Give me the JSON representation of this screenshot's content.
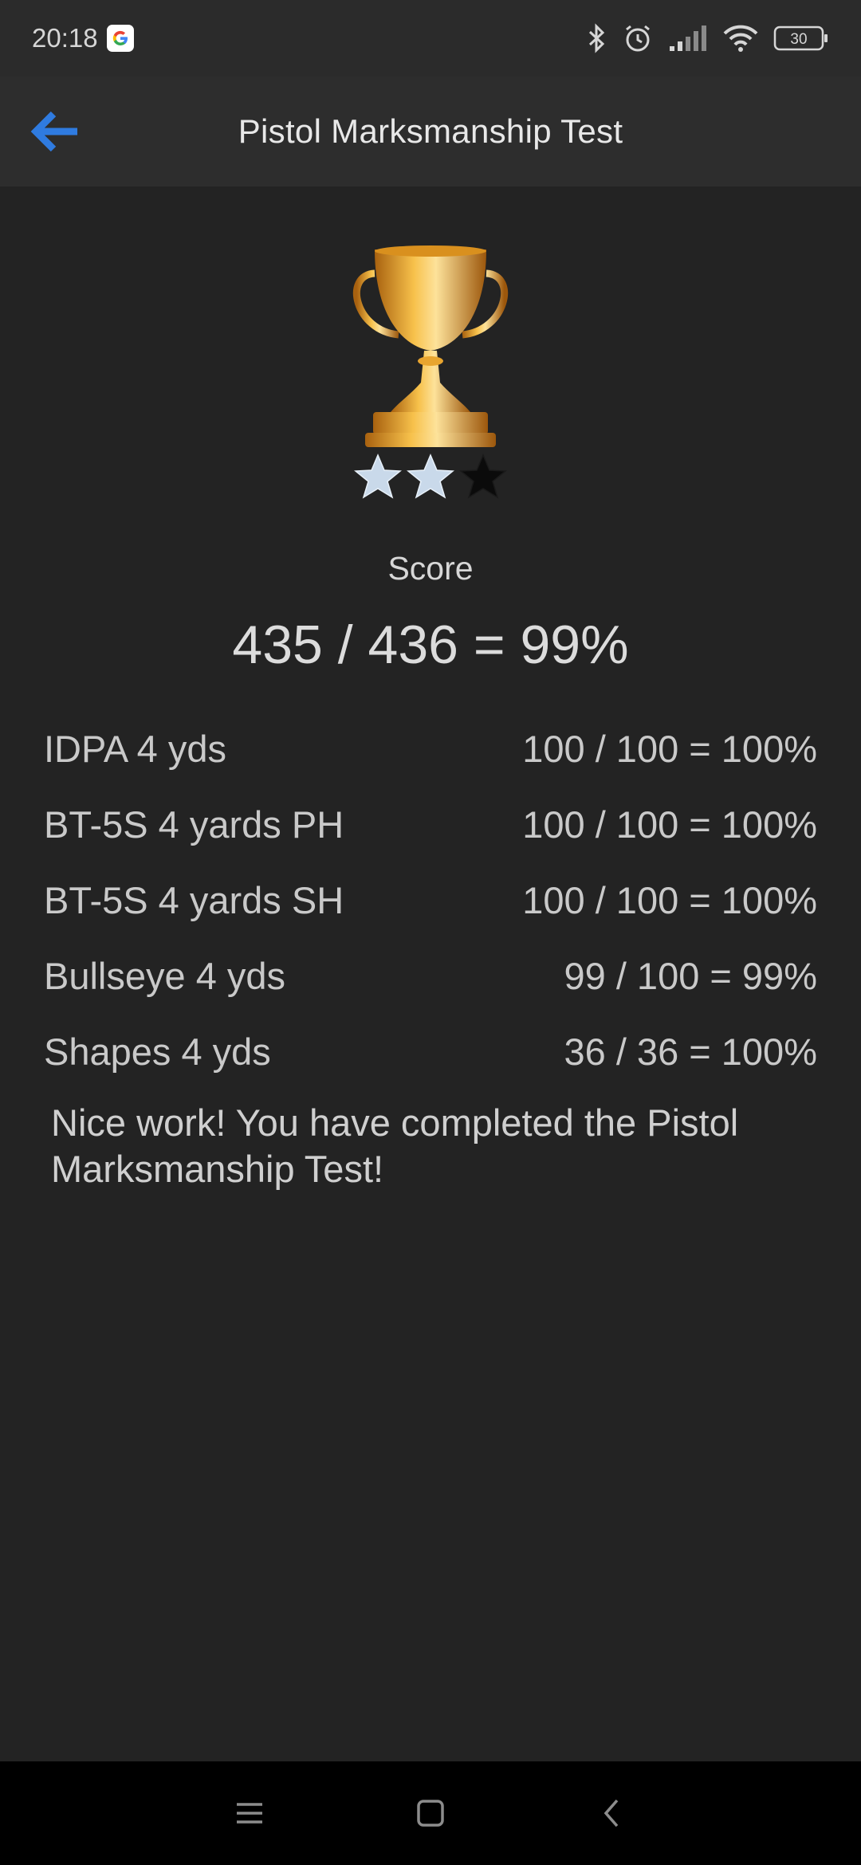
{
  "status_bar": {
    "time": "20:18",
    "battery": "30",
    "icons": [
      "google-icon",
      "bluetooth-icon",
      "alarm-icon",
      "signal-icon",
      "wifi-icon",
      "battery-icon"
    ]
  },
  "app_bar": {
    "title": "Pistol Marksmanship Test",
    "back_icon": "arrow-left-icon",
    "accent_color": "#2f7be0"
  },
  "result": {
    "trophy_icon": "trophy-icon",
    "stars_filled": 2,
    "stars_total": 3,
    "score_label": "Score",
    "score_total": "435 / 436 = 99%",
    "rows": [
      {
        "name": "IDPA 4 yds",
        "score": "100 / 100 = 100%"
      },
      {
        "name": "BT-5S 4 yards PH",
        "score": "100 / 100 = 100%"
      },
      {
        "name": "BT-5S 4 yards SH",
        "score": "100 / 100 = 100%"
      },
      {
        "name": "Bullseye 4 yds",
        "score": "99 / 100 = 99%"
      },
      {
        "name": "Shapes 4 yds",
        "score": "36 / 36 = 100%"
      }
    ],
    "message": "Nice work! You have completed the Pistol Marksmanship Test!"
  },
  "nav_bar": {
    "icons": [
      "menu-icon",
      "home-icon",
      "back-icon"
    ]
  }
}
